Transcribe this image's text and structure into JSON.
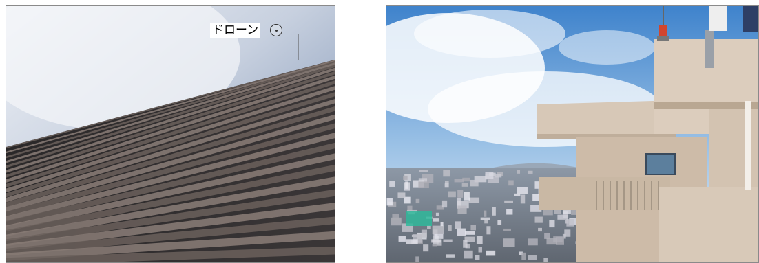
{
  "left_photo": {
    "label": "ドローン",
    "icon": "drone-marker-icon"
  },
  "right_photo": {},
  "colors": {
    "sky_left": "#c9d3e3",
    "facade_dark": "#2d2b2c",
    "sky_right": "#4f8fd0",
    "building_beige": "#d9c9b8"
  }
}
